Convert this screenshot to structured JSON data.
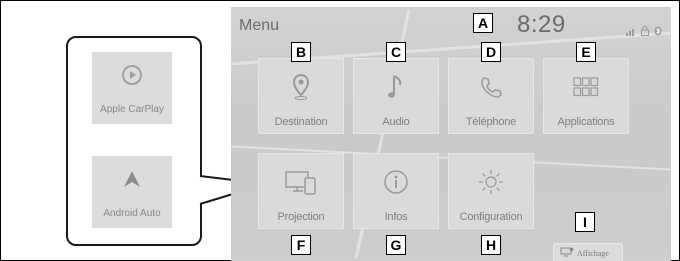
{
  "screen": {
    "title": "Menu",
    "clock": "8:29",
    "status_icons": [
      "signal-icon",
      "lock-icon",
      "bluetooth-icon"
    ]
  },
  "tiles": [
    {
      "label": "Destination",
      "icon": "map-pin-icon"
    },
    {
      "label": "Audio",
      "icon": "music-note-icon"
    },
    {
      "label": "Téléphone",
      "icon": "phone-icon"
    },
    {
      "label": "Applications",
      "icon": "app-grid-icon"
    },
    {
      "label": "Projection",
      "icon": "screen-projection-icon"
    },
    {
      "label": "Infos",
      "icon": "info-icon"
    },
    {
      "label": "Configuration",
      "icon": "gear-icon"
    }
  ],
  "affichage": {
    "label": "Affichage",
    "icon": "display-icon"
  },
  "projection_apps": [
    {
      "label": "Apple CarPlay",
      "icon": "carplay-icon"
    },
    {
      "label": "Android Auto",
      "icon": "android-auto-icon"
    }
  ],
  "markers": [
    "A",
    "B",
    "C",
    "D",
    "E",
    "F",
    "G",
    "H",
    "I"
  ],
  "colors": {
    "screen_bg": "#cccccc",
    "tile_bg": "#dadada",
    "text": "#808080",
    "marker_border": "#000000"
  }
}
